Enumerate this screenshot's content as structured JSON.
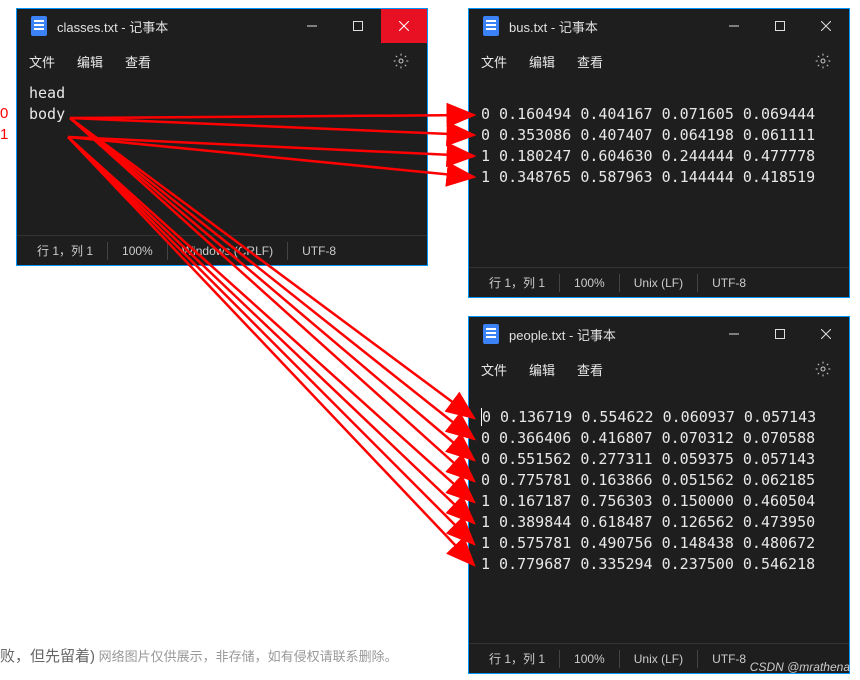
{
  "indexLabels": {
    "zero": "0",
    "one": "1"
  },
  "menu": {
    "file": "文件",
    "edit": "编辑",
    "view": "查看"
  },
  "status": {
    "cursor": "行 1，列 1",
    "zoom": "100%",
    "crlf": "Windows (CRLF)",
    "lf": "Unix (LF)",
    "encoding": "UTF-8"
  },
  "windows": {
    "classes": {
      "title": "classes.txt - 记事本",
      "lines": [
        "head",
        "body"
      ]
    },
    "bus": {
      "title": "bus.txt - 记事本",
      "lines": [
        "0 0.160494 0.404167 0.071605 0.069444",
        "0 0.353086 0.407407 0.064198 0.061111",
        "1 0.180247 0.604630 0.244444 0.477778",
        "1 0.348765 0.587963 0.144444 0.418519"
      ]
    },
    "people": {
      "title": "people.txt - 记事本",
      "lines": [
        "0 0.136719 0.554622 0.060937 0.057143",
        "0 0.366406 0.416807 0.070312 0.070588",
        "0 0.551562 0.277311 0.059375 0.057143",
        "0 0.775781 0.163866 0.051562 0.062185",
        "1 0.167187 0.756303 0.150000 0.460504",
        "1 0.389844 0.618487 0.126562 0.473950",
        "1 0.575781 0.490756 0.148438 0.480672",
        "1 0.779687 0.335294 0.237500 0.546218"
      ]
    }
  },
  "caption": {
    "main": "败，但先留着)",
    "fine": "网络图片仅供展示，非存储，如有侵权请联系删除。"
  },
  "watermark": "CSDN @mrathena"
}
